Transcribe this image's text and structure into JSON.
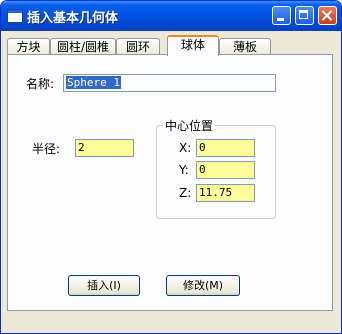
{
  "window": {
    "title": "插入基本几何体"
  },
  "tabs": [
    {
      "label": "方块"
    },
    {
      "label": "圆柱/圆椎"
    },
    {
      "label": "圆环"
    },
    {
      "label": "球体"
    },
    {
      "label": "薄板"
    }
  ],
  "active_tab": "球体",
  "form": {
    "name_label": "名称:",
    "name_value": "Sphere 1",
    "radius_label": "半径:",
    "radius_value": "2",
    "center_group_title": "中心位置",
    "x_label": "X:",
    "x_value": "0",
    "y_label": "Y:",
    "y_value": "0",
    "z_label": "Z:",
    "z_value": "11.75"
  },
  "buttons": {
    "insert_label": "插入(I)",
    "modify_label": "修改(M)"
  },
  "colors": {
    "titlebar": "#0055e5",
    "input_highlight": "#ffff99",
    "selection": "#316ac5",
    "active_tab_accent": "#e68b2c"
  },
  "icons": {
    "window": "window-icon",
    "minimize": "minimize-icon",
    "maximize": "maximize-icon",
    "close": "close-icon"
  }
}
